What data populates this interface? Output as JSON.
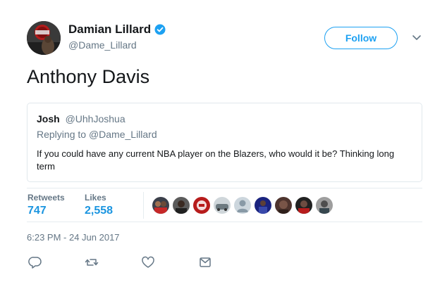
{
  "author": {
    "display_name": "Damian Lillard",
    "handle": "@Dame_Lillard",
    "avatar_icon": "profile-photo",
    "verified_icon": "verified-badge-icon"
  },
  "follow_label": "Follow",
  "tweet": {
    "text": "Anthony Davis"
  },
  "quoted_tweet": {
    "name": "Josh",
    "handle": "@UhhJoshua",
    "replying_prefix": "Replying to",
    "replying_to": "@Dame_Lillard",
    "text": "If you could have any current NBA player on the Blazers, who would it be? Thinking long term"
  },
  "stats": {
    "retweets_label": "Retweets",
    "retweets_value": "747",
    "likes_label": "Likes",
    "likes_value": "2,558"
  },
  "liker_count": 9,
  "timestamp": "6:23 PM - 24 Jun 2017",
  "actions": [
    "reply-icon",
    "retweet-icon",
    "like-icon",
    "direct-message-icon"
  ],
  "colors": {
    "accent": "#1da1f2",
    "stat_value": "#1b95e0",
    "muted": "#657786",
    "border": "#e1e8ed"
  }
}
